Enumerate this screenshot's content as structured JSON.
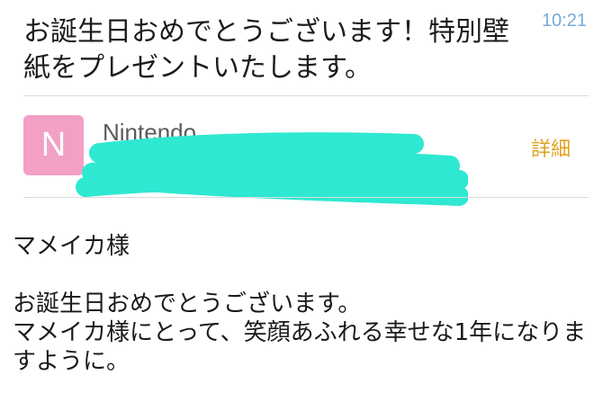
{
  "header": {
    "subject": "お誕生日おめでとうございます！特別壁紙をプレゼントいたします。",
    "time": "10:21"
  },
  "sender": {
    "avatar_letter": "N",
    "avatar_color": "#f3a0c6",
    "name": "Nintendo",
    "details_label": "詳細",
    "details_color": "#e0a21d",
    "redaction_color": "#2fe8d2"
  },
  "message": {
    "greeting": "マメイカ様",
    "lines": [
      "お誕生日おめでとうございます。",
      "マメイカ様にとって、笑顔あふれる幸せな1年になりますように。"
    ]
  }
}
